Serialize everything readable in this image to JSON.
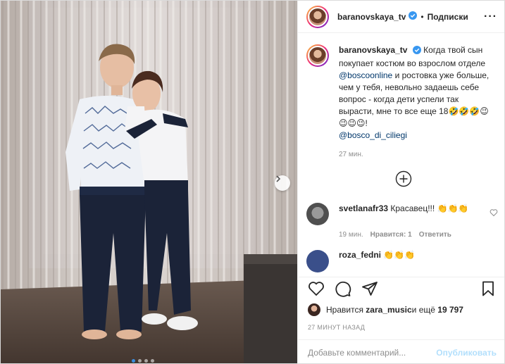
{
  "post": {
    "username": "baranovskaya_tv",
    "follow_label": "Подписки",
    "separator": "•",
    "more_label": "···",
    "verified_icon": "verified-badge-icon",
    "accent_color": "#3897f0"
  },
  "caption": {
    "username": "baranovskaya_tv",
    "text_part1": "Когда твой сын покупает костюм во взрослом отделе ",
    "mention1": "@boscoonline",
    "text_part2": " и ростовка уже больше, чем у тебя, невольно задаешь себе вопрос - когда дети успели так вырасти, мне то все еще 18🤣🤣🤣😉😉😉😉!",
    "mention2": "@bosco_di_ciliegi",
    "time": "27 мин."
  },
  "comments": [
    {
      "username": "svetlanafr33",
      "text": "Красавец!!! 👏👏👏",
      "time": "19 мин.",
      "likes": "Нравится: 1",
      "reply": "Ответить"
    }
  ],
  "partial_comment": {
    "username": "roza_fedni",
    "text": "👏👏👏"
  },
  "likes": {
    "prefix": "Нравится ",
    "user": "zara_music",
    "middle": " и ещё ",
    "count": "19 797"
  },
  "post_time": "27 МИНУТ НАЗАД",
  "add_comment": {
    "placeholder": "Добавьте комментарий...",
    "publish_label": "Опубликовать"
  },
  "carousel": {
    "total_dots": 4,
    "active_index": 0
  }
}
